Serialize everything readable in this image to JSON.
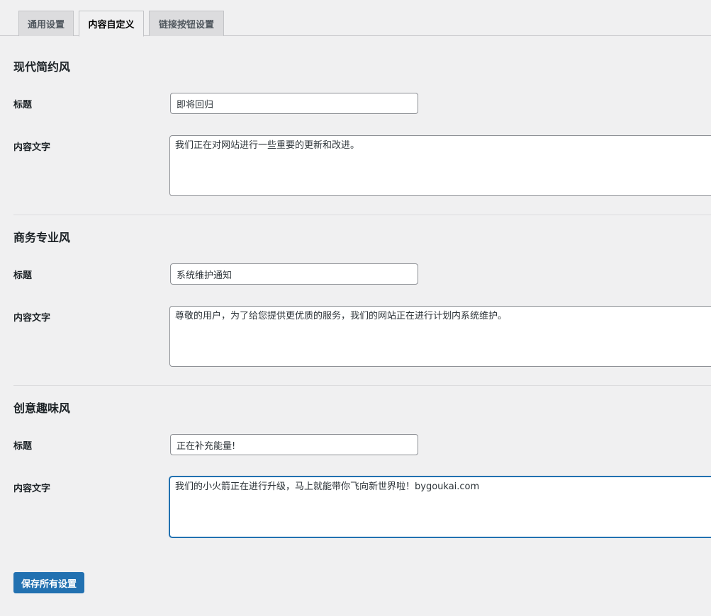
{
  "tabs": [
    {
      "label": "通用设置",
      "active": false
    },
    {
      "label": "内容自定义",
      "active": true
    },
    {
      "label": "链接按钮设置",
      "active": false
    }
  ],
  "sections": [
    {
      "title": "现代简约风",
      "title_label": "标题",
      "title_value": "即将回归",
      "content_label": "内容文字",
      "content_value": "我们正在对网站进行一些重要的更新和改进。"
    },
    {
      "title": "商务专业风",
      "title_label": "标题",
      "title_value": "系统维护通知",
      "content_label": "内容文字",
      "content_value": "尊敬的用户，为了给您提供更优质的服务，我们的网站正在进行计划内系统维护。"
    },
    {
      "title": "创意趣味风",
      "title_label": "标题",
      "title_value": "正在补充能量!",
      "content_label": "内容文字",
      "content_value": "我们的小火箭正在进行升级，马上就能带你飞向新世界啦！bygoukai.com"
    }
  ],
  "save_button_label": "保存所有设置",
  "colors": {
    "primary": "#2271b1",
    "background": "#f0f0f1",
    "tab_inactive": "#dcdcde"
  }
}
